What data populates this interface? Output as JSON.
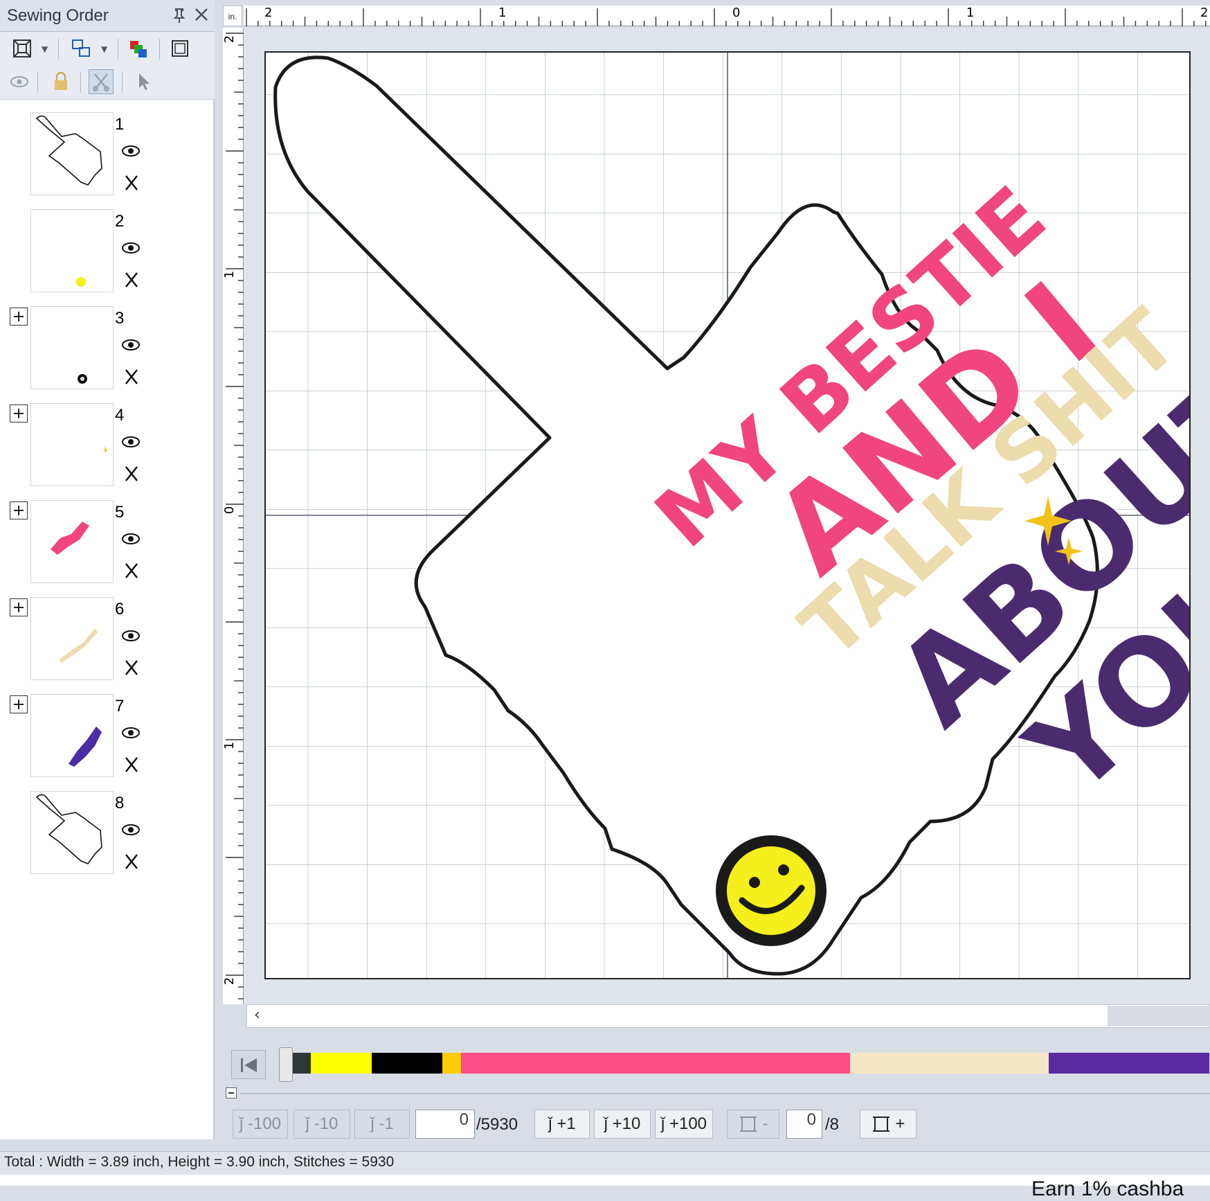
{
  "panel": {
    "title": "Sewing Order",
    "pin_icon": "pin-icon",
    "close_icon": "close-icon"
  },
  "toolbar": {
    "fit_icon": "fit-to-window-icon",
    "group_icon": "group-icon",
    "color_order_icon": "color-order-icon",
    "frame_icon": "frame-icon",
    "eye_icon": "eye-icon",
    "lock_icon": "lock-icon",
    "cut_icon": "scissors-icon",
    "select_icon": "arrow-cursor-icon"
  },
  "sequence": [
    {
      "num": "1",
      "expandable": false,
      "thumb": "outline"
    },
    {
      "num": "2",
      "expandable": false,
      "thumb": "yellow-dot"
    },
    {
      "num": "3",
      "expandable": true,
      "thumb": "black-dot"
    },
    {
      "num": "4",
      "expandable": true,
      "thumb": "gold-mark"
    },
    {
      "num": "5",
      "expandable": true,
      "thumb": "pink-text"
    },
    {
      "num": "6",
      "expandable": true,
      "thumb": "cream-text"
    },
    {
      "num": "7",
      "expandable": true,
      "thumb": "purple-text"
    },
    {
      "num": "8",
      "expandable": false,
      "thumb": "outline"
    }
  ],
  "ruler": {
    "unit": "in.",
    "top_labels": [
      "2",
      "1",
      "0",
      "1",
      "2"
    ],
    "left_labels": [
      "2",
      "1",
      "0",
      "1",
      "2"
    ]
  },
  "design": {
    "line1": "MY BESTIE",
    "line2": "AND I",
    "line3": "TALK SHIT",
    "line4": "ABOUT",
    "line5": "YOU",
    "colors": {
      "outline": "#1a1a1a",
      "pink": "#f0457e",
      "cream": "#ecdcae",
      "purple": "#4a2c6e",
      "gold": "#f2c21b",
      "yellow": "#f5ef1b"
    }
  },
  "color_strip": [
    {
      "color": "#2f3838",
      "frac": 0.028
    },
    {
      "color": "#ffff00",
      "frac": 0.066
    },
    {
      "color": "#000000",
      "frac": 0.076
    },
    {
      "color": "#ffcc00",
      "frac": 0.02
    },
    {
      "color": "#ff4d88",
      "frac": 0.421
    },
    {
      "color": "#f5e6c4",
      "frac": 0.215
    },
    {
      "color": "#5a2aa0",
      "frac": 0.174
    }
  ],
  "stepper": {
    "minus100": "-100",
    "minus10": "-10",
    "minus1": "-1",
    "stitch_value": "0",
    "stitch_total": "/5930",
    "plus1": "+1",
    "plus10": "+10",
    "plus100": "+100",
    "frame_minus": "-",
    "frame_value": "0",
    "frame_total": "/8",
    "frame_plus": "+"
  },
  "status": {
    "text": "Total : Width = 3.89 inch, Height = 3.90 inch, Stitches = 5930"
  },
  "bottom": {
    "text": "Earn 1% cashba"
  }
}
